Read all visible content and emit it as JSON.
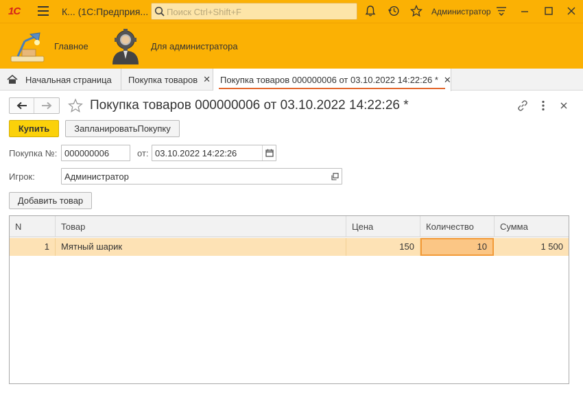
{
  "titlebar": {
    "logo": "1С",
    "app_title": "К...  (1С:Предприя...",
    "search_placeholder": "Поиск Ctrl+Shift+F",
    "user": "Администратор",
    "icons": [
      "menu-icon",
      "bell-icon",
      "history-icon",
      "star-icon",
      "settings-menu-icon",
      "minimize-icon",
      "maximize-icon",
      "close-icon"
    ]
  },
  "sections": [
    {
      "label": "Главное",
      "icon": "desk-lamp-icon"
    },
    {
      "label": "Для администратора",
      "icon": "admin-gear-icon"
    }
  ],
  "tabs": [
    {
      "label": "Начальная страница",
      "icon": "home-icon",
      "closable": false,
      "active": false
    },
    {
      "label": "Покупка товаров",
      "closable": true,
      "active": false
    },
    {
      "label": "Покупка товаров 000000006 от 03.10.2022 14:22:26 *",
      "closable": true,
      "active": true
    }
  ],
  "form": {
    "title": "Покупка товаров 000000006 от 03.10.2022 14:22:26 *",
    "buttons": {
      "buy": "Купить",
      "plan": "ЗапланироватьПокупку",
      "add_item": "Добавить товар"
    },
    "fields": {
      "number_label": "Покупка №:",
      "number_value": "000000006",
      "date_label": "от:",
      "date_value": "03.10.2022 14:22:26",
      "player_label": "Игрок:",
      "player_value": "Администратор"
    }
  },
  "table": {
    "columns": [
      "N",
      "Товар",
      "Цена",
      "Количество",
      "Сумма"
    ],
    "rows": [
      {
        "n": "1",
        "item": "Мятный шарик",
        "price": "150",
        "qty": "10",
        "sum": "1 500"
      }
    ]
  },
  "colors": {
    "brand_orange": "#fbb104",
    "primary_button": "#fbd10a",
    "selected_row": "#fde2b5",
    "active_tab_underline": "#e3672d"
  }
}
